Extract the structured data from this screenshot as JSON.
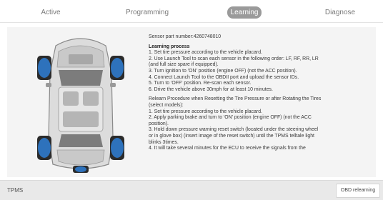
{
  "tabs": [
    {
      "label": "Active"
    },
    {
      "label": "Programming"
    },
    {
      "label": "Learning",
      "selected": true
    },
    {
      "label": "Diagnose"
    }
  ],
  "sensor": {
    "part_number": "Sensor part number:4260748010"
  },
  "learning_process": {
    "heading": "Learning process",
    "lines": [
      "1. Set tire pressure according to the vehicle placard.",
      "2. Use Launch Tool to scan each sensor in the following order: LF, RF, RR, LR",
      "(and full size spare if equipped).",
      "3. Turn ignition to 'ON' position (engine OFF) (not the ACC position).",
      "4. Connect Launch Tool to the OBDII port and upload the sensor IDs.",
      "5. Turn to 'OFF' position. Re-scan each sensor.",
      "6. Drive the vehicle above 30mph for at least 10 minutes."
    ]
  },
  "relearn": {
    "heading_lines": [
      "Relearn Procedure when Resetting the Tire Pressure or after Rotating the Tires",
      "(select models):"
    ],
    "lines": [
      "1. Set tire pressure according to the vehicle placard.",
      "2. Apply parking brake and turn to 'ON' position (engine OFF) (not the ACC",
      "position).",
      "3. Hold down pressure warning reset switch (located under the steering wheel",
      "or in glove box) (insert image of the reset switch) until the TPMS telltale light",
      "blinks 3times.",
      "4. It will take several minutes for the ECU to receive the signals from the"
    ]
  },
  "footer": {
    "label": "TPMS",
    "button_label": "OBD relearning"
  },
  "colors": {
    "tab_selected_bg": "#9a9a9a",
    "sensor_blue": "#2f7fd6",
    "tire": "#2b2b2b"
  }
}
